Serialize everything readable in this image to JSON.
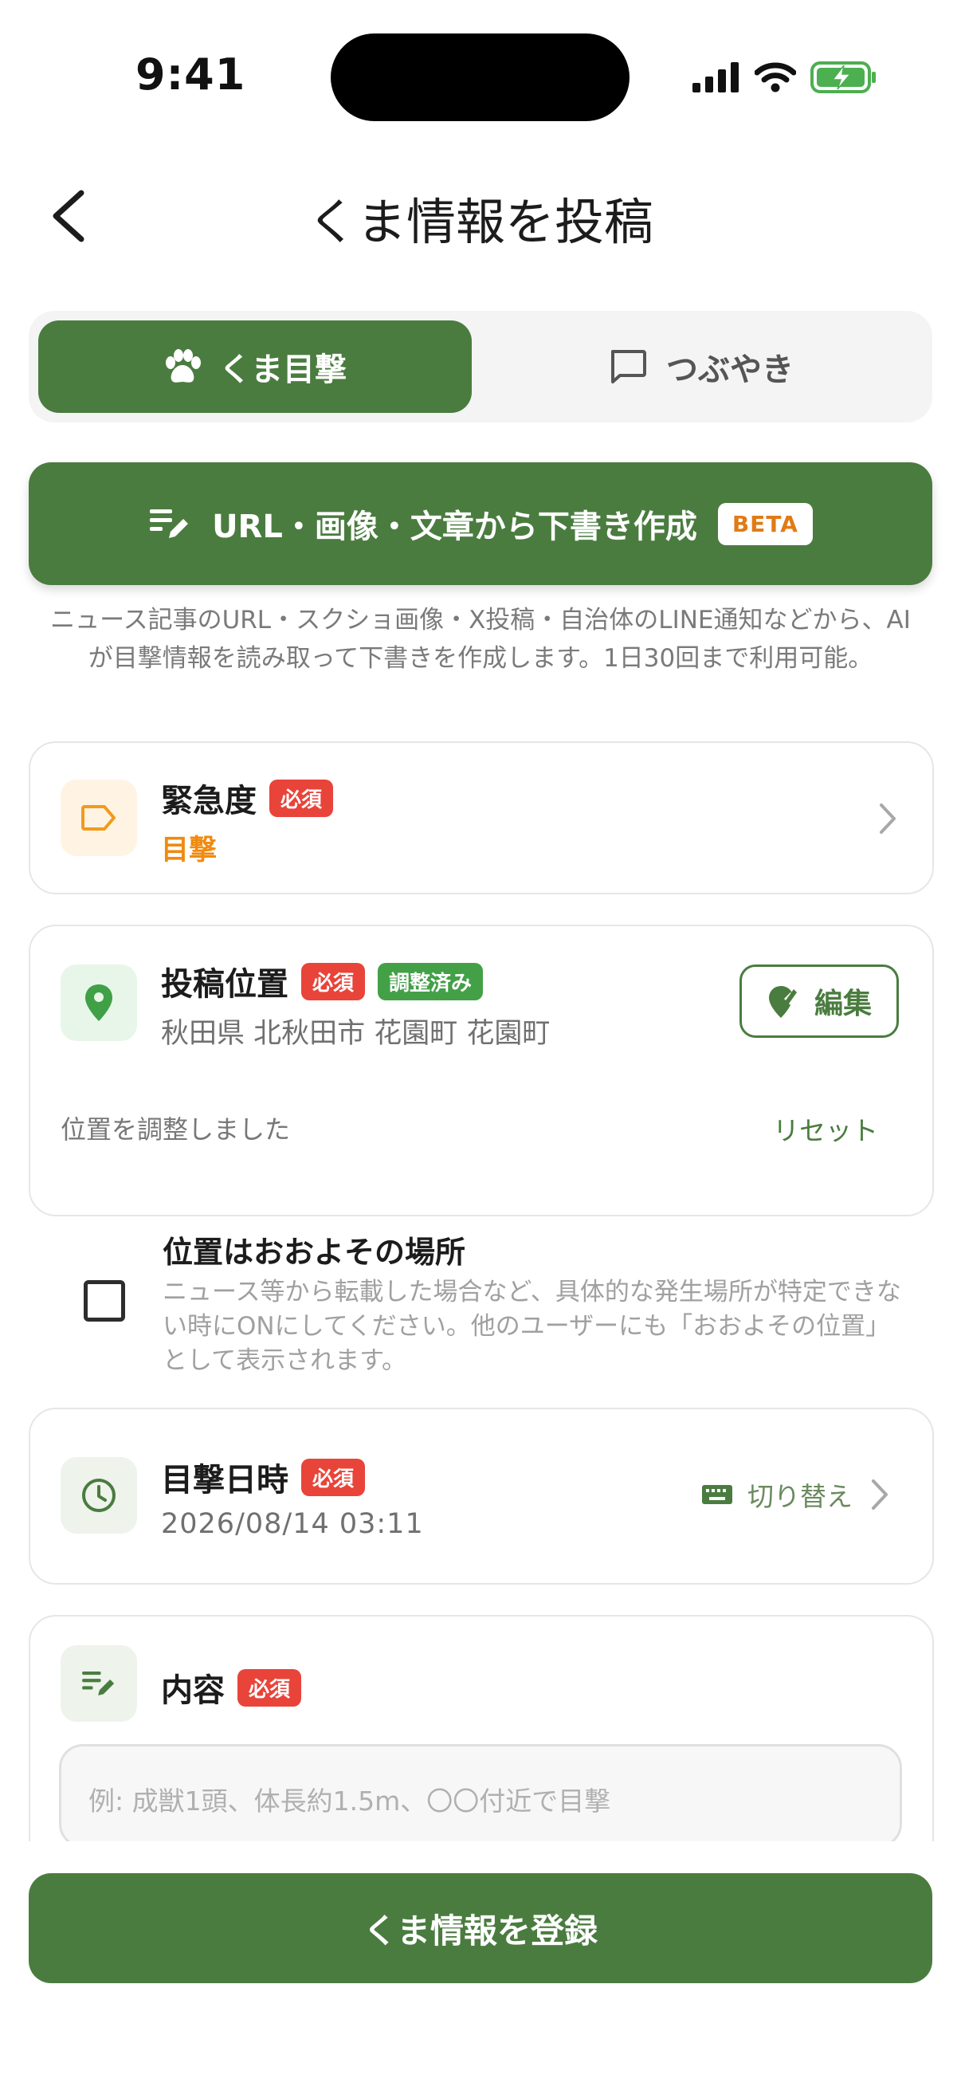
{
  "status_bar": {
    "time": "9:41"
  },
  "header": {
    "title": "くま情報を投稿"
  },
  "tabs": [
    {
      "label": "くま目撃",
      "active": true
    },
    {
      "label": "つぶやき",
      "active": false
    }
  ],
  "draft": {
    "label": "URL・画像・文章から下書き作成",
    "badge": "BETA",
    "description": "ニュース記事のURL・スクショ画像・X投稿・自治体のLINE通知などから、AIが目撃情報を読み取って下書きを作成します。1日30回まで利用可能。"
  },
  "urgency": {
    "label": "緊急度",
    "required": "必須",
    "value": "目撃"
  },
  "location": {
    "label": "投稿位置",
    "required": "必須",
    "adjusted_badge": "調整済み",
    "address": "秋田県 北秋田市 花園町 花園町",
    "edit_label": "編集",
    "adjusted_note": "位置を調整しました",
    "reset_label": "リセット"
  },
  "approx": {
    "label": "位置はおおよその場所",
    "description": "ニュース等から転載した場合など、具体的な発生場所が特定できない時にONにしてください。他のユーザーにも「おおよその位置」として表示されます。",
    "checked": false
  },
  "datetime": {
    "label": "目撃日時",
    "required": "必須",
    "value": "2026/08/14 03:11",
    "toggle_label": "切り替え"
  },
  "content": {
    "label": "内容",
    "required": "必須",
    "placeholder": "例: 成獣1頭、体長約1.5m、〇〇付近で目撃"
  },
  "submit": {
    "label": "くま情報を登録"
  },
  "colors": {
    "primary": "#4a7c3f",
    "required": "#e8443a",
    "adjusted": "#43a047",
    "urgency": "#f08a10",
    "beta": "#e07b16"
  }
}
